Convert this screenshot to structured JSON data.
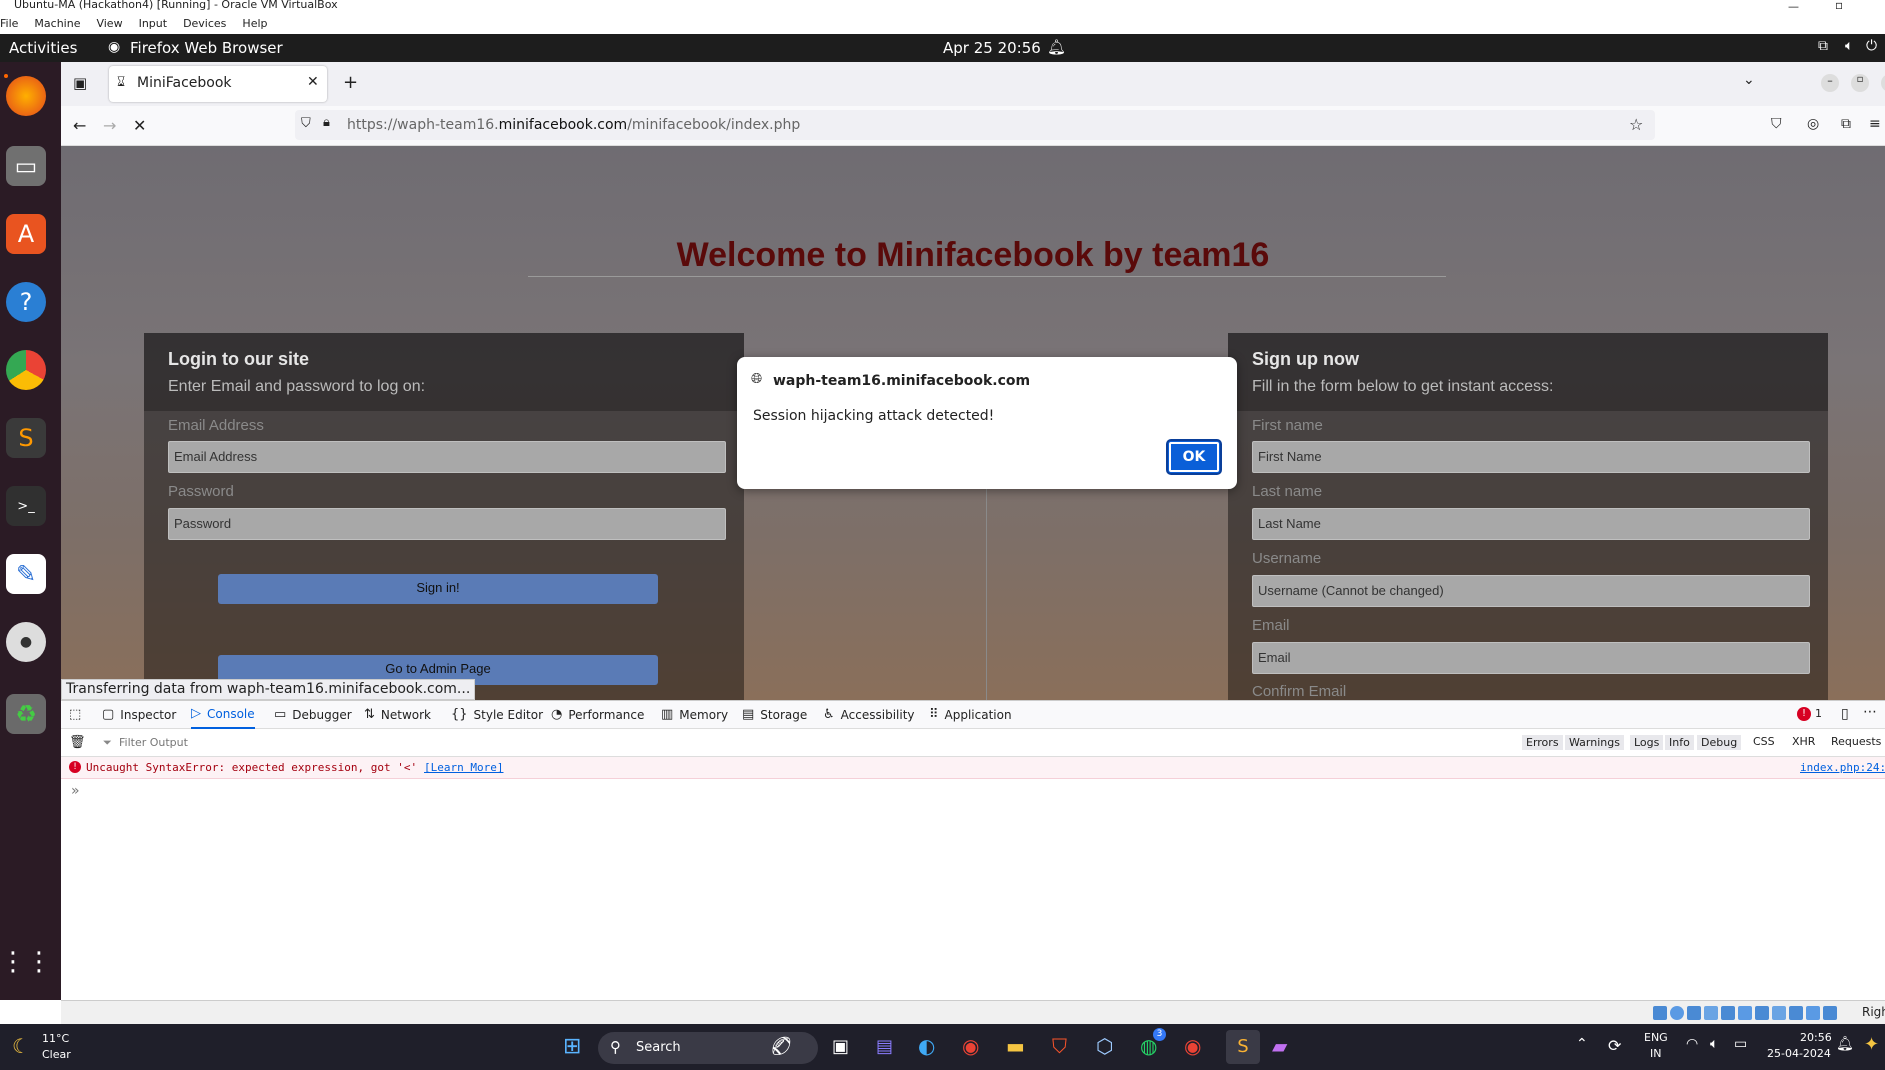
{
  "vbox": {
    "title": "Ubuntu-MA (Hackathon4) [Running] - Oracle VM VirtualBox",
    "menu": [
      "File",
      "Machine",
      "View",
      "Input",
      "Devices",
      "Help"
    ]
  },
  "ubuntu": {
    "activities": "Activities",
    "app_name": "Firefox Web Browser",
    "clock": "Apr 25  20:56"
  },
  "browser": {
    "tab_title": "MiniFacebook",
    "url_prefix": "https://waph-team16.",
    "url_domain": "minifacebook.com",
    "url_path": "/minifacebook/index.php",
    "status_text": "Transferring data from waph-team16.minifacebook.com..."
  },
  "page": {
    "heading": "Welcome to Minifacebook by team16",
    "login": {
      "title": "Login to our site",
      "subtitle": "Enter Email and password to log on:",
      "email_label": "Email Address",
      "email_placeholder": "Email Address",
      "password_label": "Password",
      "password_placeholder": "Password",
      "signin_label": "Sign in!",
      "admin_label": "Go to Admin Page"
    },
    "signup": {
      "title": "Sign up now",
      "subtitle": "Fill in the form below to get instant access:",
      "first_label": "First name",
      "first_placeholder": "First Name",
      "last_label": "Last name",
      "last_placeholder": "Last Name",
      "username_label": "Username",
      "username_placeholder": "Username (Cannot be changed)",
      "email_label": "Email",
      "email_placeholder": "Email",
      "confirm_label": "Confirm Email"
    }
  },
  "dialog": {
    "origin": "waph-team16.minifacebook.com",
    "message": "Session hijacking attack detected!",
    "ok_label": "OK"
  },
  "devtools": {
    "tabs": [
      "Inspector",
      "Console",
      "Debugger",
      "Network",
      "Style Editor",
      "Performance",
      "Memory",
      "Storage",
      "Accessibility",
      "Application"
    ],
    "active_tab": "Console",
    "error_count": "1",
    "filter_placeholder": "Filter Output",
    "filters": [
      "Errors",
      "Warnings",
      "Logs",
      "Info",
      "Debug",
      "CSS",
      "XHR",
      "Requests"
    ],
    "error_message": "Uncaught SyntaxError: expected expression, got '<'",
    "learn_more": "[Learn More]",
    "error_source": "index.php:24:"
  },
  "taskbar": {
    "temp": "11°C",
    "weather": "Clear",
    "search_label": "Search",
    "lang_top": "ENG",
    "lang_bottom": "IN",
    "time": "20:56",
    "date": "25-04-2024",
    "whatsapp_badge": "3",
    "vbox_right": "Righ"
  }
}
